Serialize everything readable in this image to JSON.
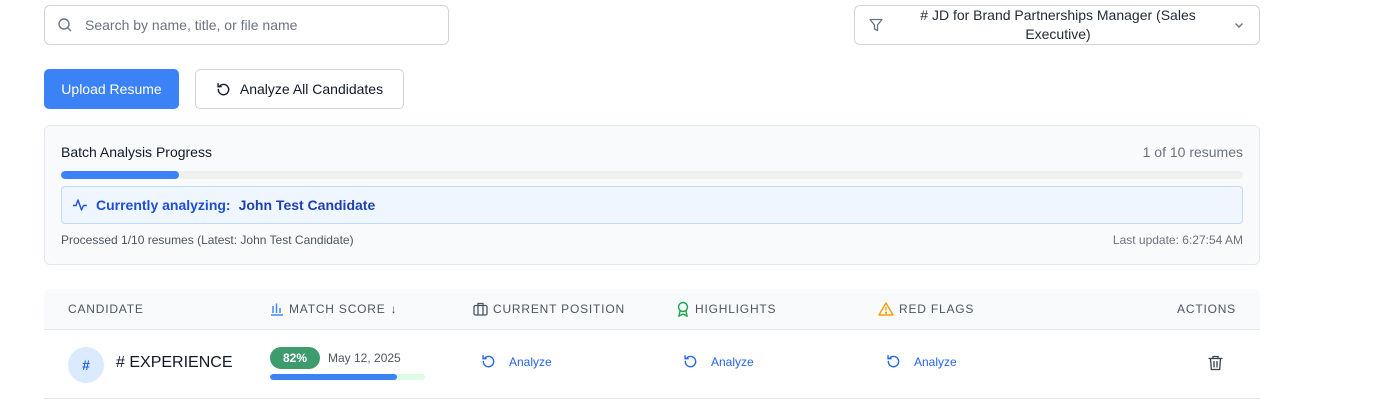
{
  "search": {
    "placeholder": "Search by name, title, or file name"
  },
  "filter": {
    "selected": "# JD for Brand Partnerships Manager (Sales Executive)"
  },
  "actions": {
    "upload_label": "Upload Resume",
    "analyze_all_label": "Analyze All Candidates"
  },
  "batch": {
    "title": "Batch Analysis Progress",
    "count_text": "1 of 10 resumes",
    "progress_fraction": 0.1,
    "current_prefix": "Currently analyzing:",
    "current_name": "John Test Candidate",
    "processed_text": "Processed 1/10 resumes (Latest: John Test Candidate)",
    "last_update": "Last update: 6:27:54 AM"
  },
  "table": {
    "headers": {
      "candidate": "CANDIDATE",
      "match_score": "MATCH SCORE",
      "sort_arrow": "↓",
      "current_position": "CURRENT POSITION",
      "highlights": "HIGHLIGHTS",
      "red_flags": "RED FLAGS",
      "actions": "ACTIONS"
    },
    "rows": [
      {
        "avatar": "#",
        "name": "# EXPERIENCE",
        "score": "82%",
        "score_fraction": 0.82,
        "date": "May 12, 2025",
        "position_action": "Analyze",
        "highlights_action": "Analyze",
        "red_flags_action": "Analyze"
      }
    ]
  },
  "colors": {
    "primary": "#3b82f6",
    "success": "#3d9b6d",
    "warning": "#f59e0b",
    "highlight_icon": "#16a34a"
  },
  "icons": [
    "search-icon",
    "filter-icon",
    "chevron-down-icon",
    "refresh-icon",
    "activity-icon",
    "bar-chart-icon",
    "briefcase-icon",
    "award-icon",
    "alert-triangle-icon",
    "trash-icon"
  ]
}
